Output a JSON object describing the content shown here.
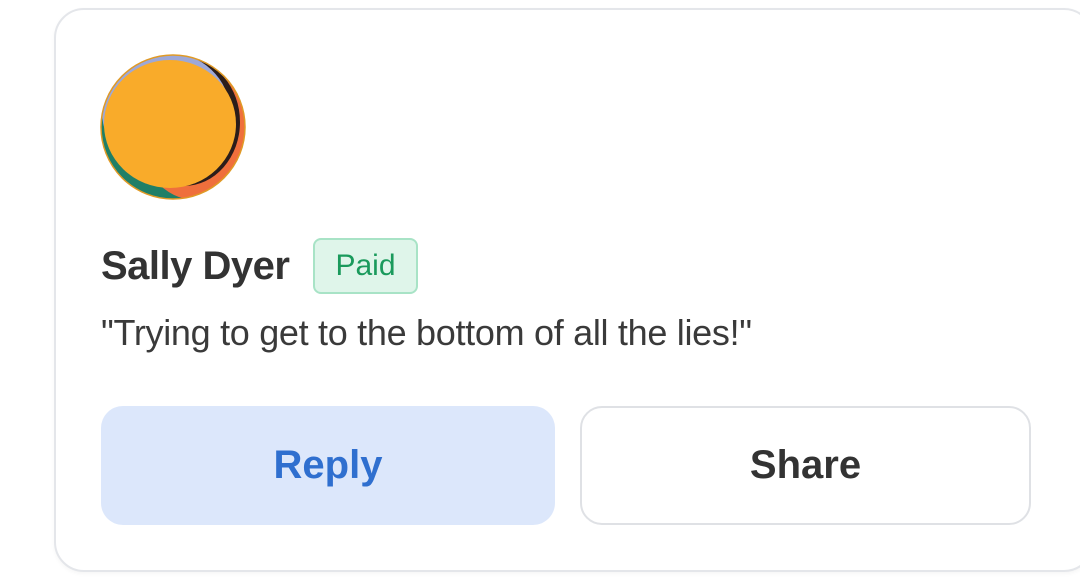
{
  "comment": {
    "author": "Sally Dyer",
    "badge": "Paid",
    "text": "\"Trying to get to the bottom of all the lies!\""
  },
  "actions": {
    "reply_label": "Reply",
    "share_label": "Share"
  },
  "colors": {
    "reply_bg": "#dce7fb",
    "reply_text": "#2f6fcf",
    "badge_bg": "#dff5ea",
    "badge_text": "#1a9a5c",
    "avatar_main": "#f9ab2a",
    "avatar_green": "#1f7f67",
    "avatar_orange": "#ef6f3c",
    "avatar_purple": "#9da8d8"
  },
  "icons": {
    "avatar": "avatar-image"
  }
}
